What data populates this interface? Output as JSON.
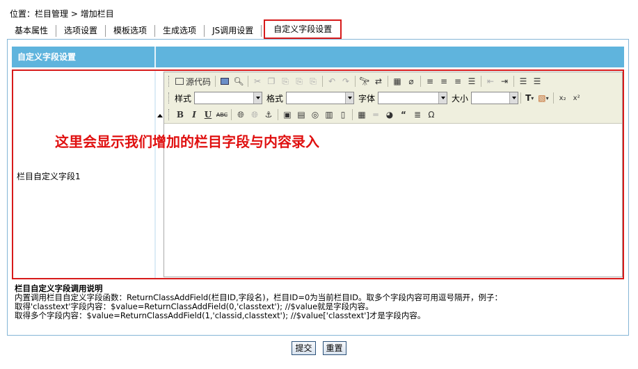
{
  "breadcrumb": {
    "prefix": "位置：",
    "path": "栏目管理 > 增加栏目"
  },
  "tabs": [
    {
      "label": "基本属性"
    },
    {
      "label": "选项设置"
    },
    {
      "label": "模板选项"
    },
    {
      "label": "生成选项"
    },
    {
      "label": "JS调用设置"
    },
    {
      "label": "自定义字段设置",
      "active": true
    }
  ],
  "panel": {
    "title": "自定义字段设置"
  },
  "field": {
    "label": "栏目自定义字段1",
    "annotation": "这里会显示我们增加的栏目字段与内容录入"
  },
  "editor": {
    "source_label": "源代码",
    "style_label": "样式",
    "format_label": "格式",
    "font_label": "字体",
    "size_label": "大小"
  },
  "help": {
    "title": "栏目自定义字段调用说明",
    "line1": "内置调用栏目自定义字段函数：ReturnClassAddField(栏目ID,字段名)，栏目ID=0为当前栏目ID。取多个字段内容可用逗号隔开，例子：",
    "line2": "取得'classtext'字段内容：$value=ReturnClassAddField(0,'classtext'); //$value就是字段内容。",
    "line3": "取得多个字段内容：$value=ReturnClassAddField(1,'classid,classtext'); //$value['classtext']才是字段内容。"
  },
  "buttons": {
    "submit": "提交",
    "reset": "重置"
  },
  "colors": {
    "header_bg": "#5fb4dd",
    "highlight": "#d71a1a",
    "toolbar_bg": "#efefde"
  }
}
